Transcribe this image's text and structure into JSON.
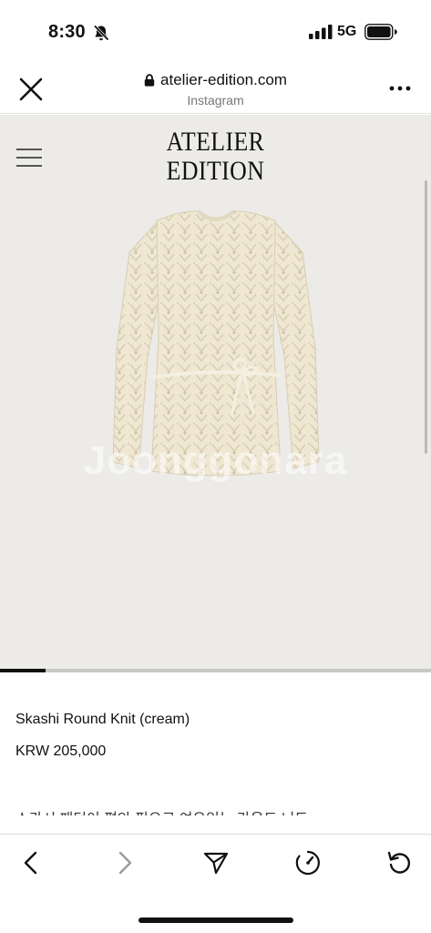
{
  "status_bar": {
    "time": "8:30",
    "network": "5G",
    "icons": [
      "bell-slash-icon",
      "signal-bars-icon",
      "battery-icon"
    ]
  },
  "browser": {
    "url": "atelier-edition.com",
    "source_app": "Instagram",
    "icons": [
      "close-icon",
      "lock-icon",
      "more-icon"
    ]
  },
  "hero": {
    "logo_line1": "ATELIER",
    "logo_line2": "EDITION",
    "watermark": "Joonggonara",
    "image_progress": 0.105,
    "background_color": "#ecebe7",
    "product_color": "#efe7d2"
  },
  "product": {
    "name": "Skashi Round Knit (cream)",
    "price": "KRW 205,000",
    "description_partial": "스카시 패턴이 편안 핏으로 여유있는 라운드 니트"
  },
  "toolbar": {
    "icons": [
      "back-icon",
      "forward-icon",
      "share-icon",
      "speed-icon",
      "reload-icon"
    ]
  }
}
